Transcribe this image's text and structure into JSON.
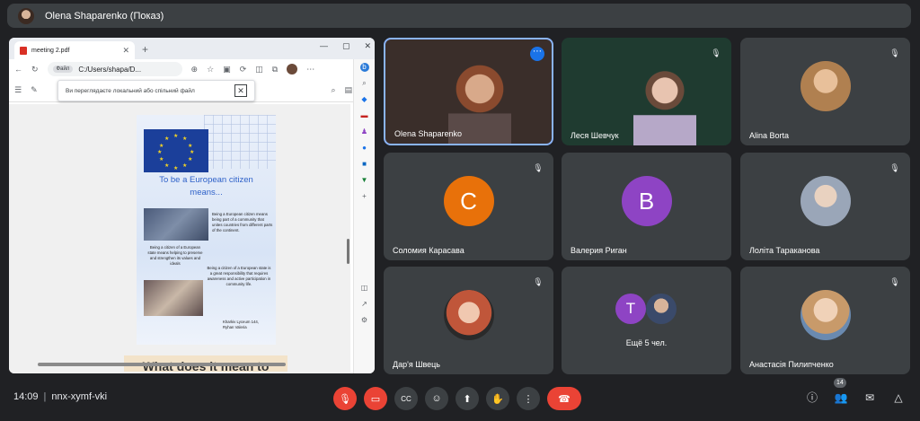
{
  "presenter_bar": {
    "name": "Olena Shaparenko (Показ)"
  },
  "browser": {
    "tab_title": "meeting 2.pdf",
    "address_chip": "Файл",
    "url": "C:/Users/shapa/D...",
    "popup_text": "Ви переглядаєте локальний або спільний файл",
    "pdf": {
      "title_line1": "To be a European citizen",
      "title_line2": "means...",
      "text1": "Being a European citizen means being part of a community that unites countries from different parts of the continent.",
      "text2": "Being a citizen of a European state means helping to preserve and strengthen its values and ideals",
      "text3": "Being a citizen of a European state is a great responsibility that requires awareness and active participation in community life.",
      "credit1": "Kharkiv Lyceum 144,",
      "credit2": "Ryhan Valeria",
      "next_title": "What does it mean to"
    }
  },
  "participants": [
    {
      "name": "Olena Shaparenko",
      "type": "video"
    },
    {
      "name": "Леся Шевчук",
      "type": "video"
    },
    {
      "name": "Alina Borta",
      "type": "photo"
    },
    {
      "name": "Соломия Карасава",
      "type": "letter",
      "letter": "C",
      "color": "#e8710a"
    },
    {
      "name": "Валерия Риган",
      "type": "letter",
      "letter": "B",
      "color": "#8e44c4"
    },
    {
      "name": "Лоліта Тараканова",
      "type": "photo"
    },
    {
      "name": "Дар'я Швець",
      "type": "photo"
    },
    {
      "name": "Ещё 5 чел.",
      "type": "more",
      "letter": "T",
      "color": "#8e44c4"
    },
    {
      "name": "Анастасія Пилипченко",
      "type": "photo"
    }
  ],
  "bottom": {
    "time": "14:09",
    "meeting_code": "nnx-xymf-vki",
    "participants_count": "14"
  },
  "colors": {
    "background": "#202124",
    "tile": "#3c4043",
    "danger": "#ea4335",
    "accent": "#8ab4f8"
  }
}
